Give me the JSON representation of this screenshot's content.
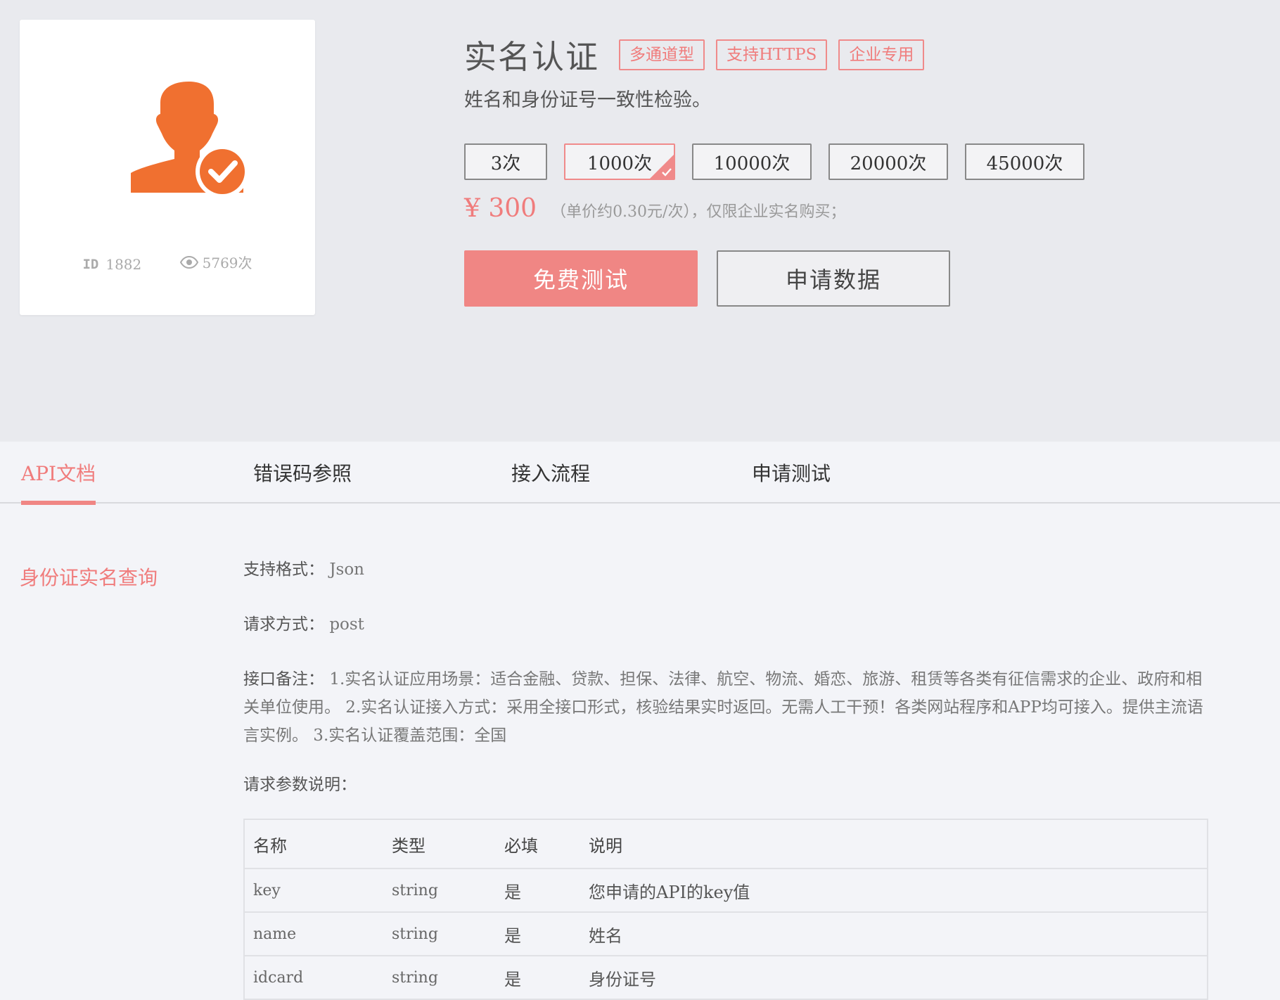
{
  "product": {
    "title": "实名认证",
    "tags": [
      "多通道型",
      "支持HTTPS",
      "企业专用"
    ],
    "subtitle": "姓名和身份证号一致性检验。",
    "id_label": "ID",
    "id_value": "1882",
    "views": "5769次",
    "icon": "user-verified-icon",
    "accent_color": "#f08684",
    "icon_color": "#f07030"
  },
  "packages": [
    {
      "label": "3次",
      "selected": false
    },
    {
      "label": "1000次",
      "selected": true
    },
    {
      "label": "10000次",
      "selected": false
    },
    {
      "label": "20000次",
      "selected": false
    },
    {
      "label": "45000次",
      "selected": false
    }
  ],
  "price": {
    "amount": "¥ 300",
    "note": "（单价约0.30元/次），仅限企业实名购买；"
  },
  "actions": {
    "free_test": "免费测试",
    "apply_data": "申请数据"
  },
  "tabs": [
    {
      "label": "API文档",
      "active": true
    },
    {
      "label": "错误码参照",
      "active": false
    },
    {
      "label": "接入流程",
      "active": false
    },
    {
      "label": "申请测试",
      "active": false
    }
  ],
  "doc": {
    "section_title": "身份证实名查询",
    "format_label": "支持格式：",
    "format_value": "Json",
    "method_label": "请求方式：",
    "method_value": "post",
    "remark_label": "接口备注：",
    "remark_value": "1.实名认证应用场景：适合金融、贷款、担保、法律、航空、物流、婚恋、旅游、租赁等各类有征信需求的企业、政府和相关单位使用。 2.实名认证接入方式：采用全接口形式，核验结果实时返回。无需人工干预！各类网站程序和APP均可接入。提供主流语言实例。 3.实名认证覆盖范围：全国",
    "params_label": "请求参数说明：",
    "table_headers": [
      "名称",
      "类型",
      "必填",
      "说明"
    ],
    "table_rows": [
      [
        "key",
        "string",
        "是",
        "您申请的API的key值"
      ],
      [
        "name",
        "string",
        "是",
        "姓名"
      ],
      [
        "idcard",
        "string",
        "是",
        "身份证号"
      ]
    ]
  }
}
